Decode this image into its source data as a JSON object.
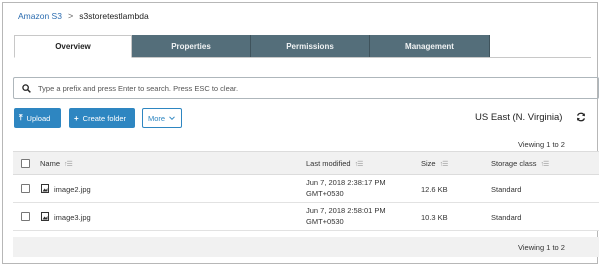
{
  "breadcrumb": {
    "root": "Amazon S3",
    "separator": ">",
    "current": "s3storetestlambda"
  },
  "tabs": [
    {
      "label": "Overview",
      "active": true
    },
    {
      "label": "Properties",
      "active": false
    },
    {
      "label": "Permissions",
      "active": false
    },
    {
      "label": "Management",
      "active": false
    }
  ],
  "search": {
    "placeholder": "Type a prefix and press Enter to search. Press ESC to clear.",
    "value": ""
  },
  "toolbar": {
    "upload_label": "Upload",
    "create_folder_label": "Create folder",
    "more_label": "More"
  },
  "region": "US East (N. Virginia)",
  "viewing_text": "Viewing 1 to 2",
  "table": {
    "columns": {
      "name": "Name",
      "last_modified": "Last modified",
      "size": "Size",
      "storage_class": "Storage class"
    },
    "rows": [
      {
        "name": "image2.jpg",
        "modified_line1": "Jun 7, 2018 2:38:17 PM",
        "modified_line2": "GMT+0530",
        "size": "12.6 KB",
        "storage_class": "Standard"
      },
      {
        "name": "image3.jpg",
        "modified_line1": "Jun 7, 2018 2:58:01 PM",
        "modified_line2": "GMT+0530",
        "size": "10.3 KB",
        "storage_class": "Standard"
      }
    ]
  },
  "colors": {
    "accent": "#2e86c1",
    "tab_inactive": "#546e7a",
    "link": "#2b6cb0"
  },
  "icons": {
    "upload": "upload-icon",
    "create_folder": "plus-icon",
    "more": "chevron-down-icon",
    "refresh": "refresh-icon",
    "search": "search-icon",
    "file": "image-file-icon",
    "sort": "sort-icon"
  }
}
